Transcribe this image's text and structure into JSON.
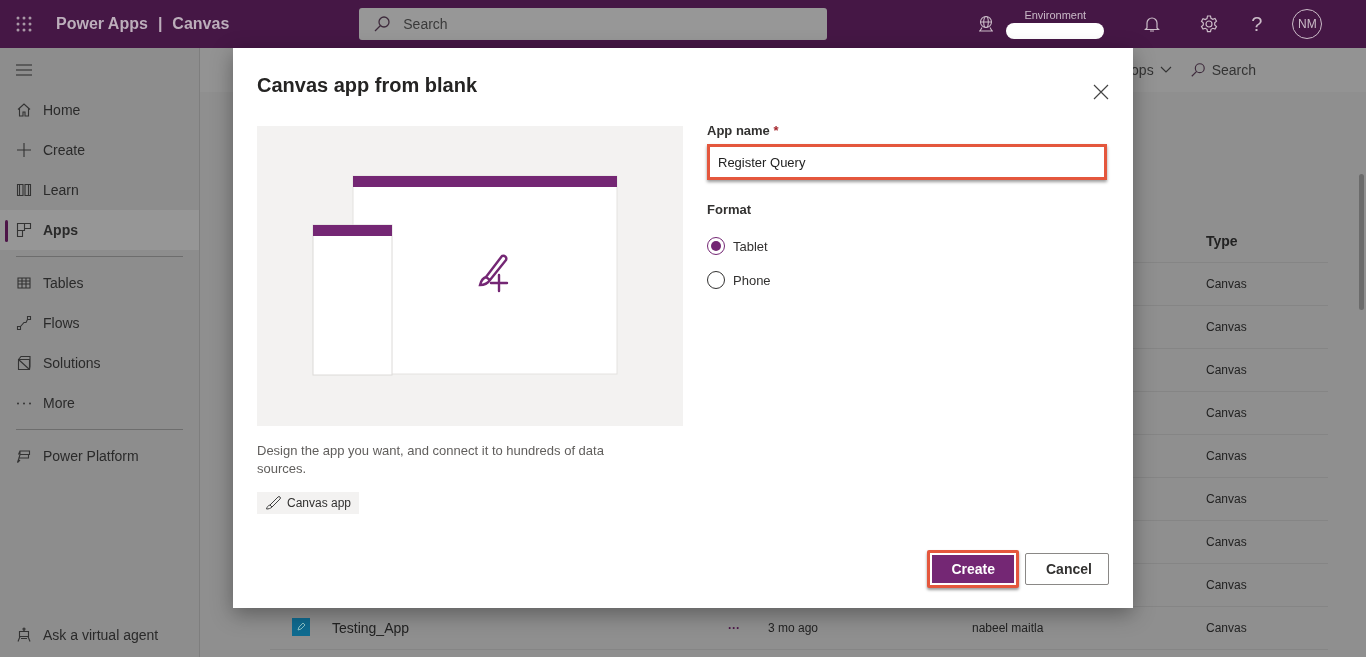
{
  "topbar": {
    "product": "Power Apps",
    "separator": "|",
    "section": "Canvas",
    "search": {
      "placeholder": "Search"
    },
    "environment": {
      "label": "Environment"
    },
    "help": "?",
    "avatar": "NM"
  },
  "sidebar": {
    "items": [
      {
        "label": "Home",
        "selected": false
      },
      {
        "label": "Create",
        "selected": false
      },
      {
        "label": "Learn",
        "selected": false
      },
      {
        "label": "Apps",
        "selected": true
      },
      {
        "label": "Tables",
        "selected": false
      },
      {
        "label": "Flows",
        "selected": false
      },
      {
        "label": "Solutions",
        "selected": false
      },
      {
        "label": "More",
        "selected": false
      },
      {
        "label": "Power Platform",
        "selected": false
      }
    ],
    "footer": {
      "label": "Ask a virtual agent"
    }
  },
  "toolbar": {
    "filter": "ops",
    "search": "Search"
  },
  "table": {
    "columns": [
      "Type"
    ],
    "rows": [
      {
        "type": "Canvas"
      },
      {
        "type": "Canvas"
      },
      {
        "type": "Canvas"
      },
      {
        "type": "Canvas"
      },
      {
        "type": "Canvas"
      },
      {
        "type": "Canvas"
      },
      {
        "type": "Canvas"
      },
      {
        "type": "Canvas"
      },
      {
        "name": "Testing_App",
        "more": "···",
        "modified": "3 mo ago",
        "owner": "nabeel maitla",
        "type": "Canvas"
      }
    ]
  },
  "dialog": {
    "title": "Canvas app from blank",
    "description": "Design the app you want, and connect it to hundreds of data sources.",
    "tag": "Canvas app",
    "app_name": {
      "label": "App name",
      "required_mark": "*",
      "value": "Register Query",
      "highlighted": true
    },
    "format": {
      "label": "Format",
      "options": [
        {
          "label": "Tablet",
          "selected": true
        },
        {
          "label": "Phone",
          "selected": false
        }
      ]
    },
    "buttons": [
      {
        "label": "Create",
        "kind": "primary",
        "highlighted": true
      },
      {
        "label": "Cancel",
        "kind": "secondary",
        "highlighted": false
      }
    ]
  }
}
